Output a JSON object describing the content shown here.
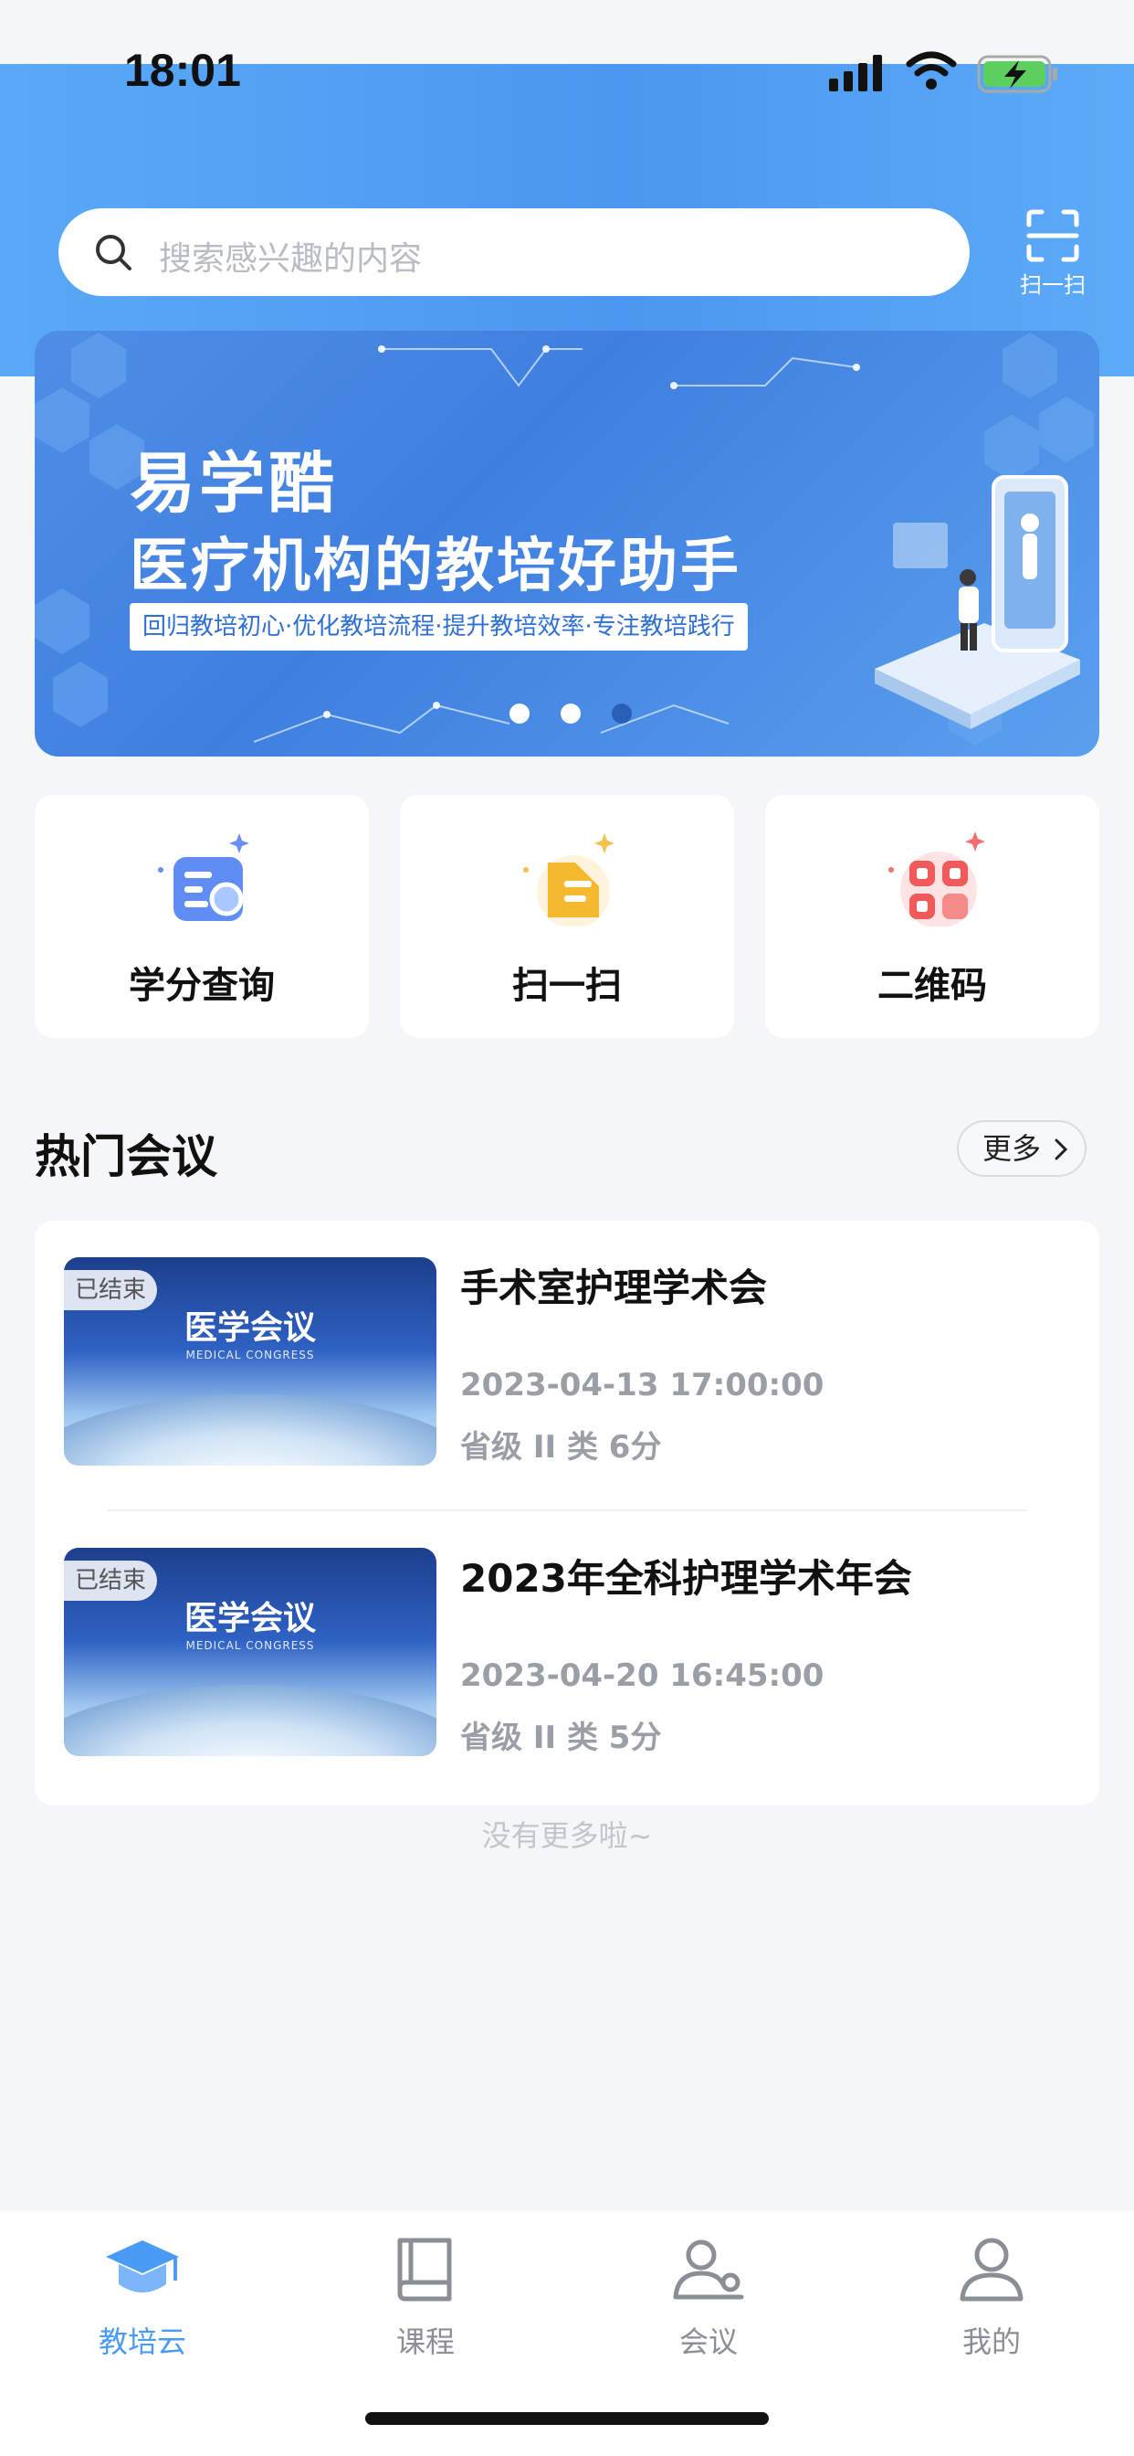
{
  "status_bar": {
    "time": "18:01"
  },
  "search": {
    "placeholder": "搜索感兴趣的内容",
    "scan_label": "扫一扫"
  },
  "banner": {
    "title": "易学酷",
    "subtitle": "医疗机构的教培好助手",
    "tagline": "回归教培初心·优化教培流程·提升教培效率·专注教培践行",
    "dots": 3,
    "active_dot": 2
  },
  "quick_actions": [
    {
      "label": "学分查询",
      "icon": "credit-query-icon"
    },
    {
      "label": "扫一扫",
      "icon": "scan-icon"
    },
    {
      "label": "二维码",
      "icon": "qrcode-icon"
    }
  ],
  "hot_meetings": {
    "title": "热门会议",
    "more_label": "更多",
    "items": [
      {
        "badge": "已结束",
        "thumb_title": "医学会议",
        "thumb_sub": "MEDICAL CONGRESS",
        "title": "手术室护理学术会",
        "time": "2023-04-13 17:00:00",
        "credit": "省级 II 类 6分"
      },
      {
        "badge": "已结束",
        "thumb_title": "医学会议",
        "thumb_sub": "MEDICAL CONGRESS",
        "title": "2023年全科护理学术年会",
        "time": "2023-04-20 16:45:00",
        "credit": "省级 II 类 5分"
      }
    ],
    "end_text": "没有更多啦~"
  },
  "tabbar": {
    "items": [
      {
        "label": "教培云",
        "icon": "graduation-cap-icon",
        "active": true
      },
      {
        "label": "课程",
        "icon": "book-icon",
        "active": false
      },
      {
        "label": "会议",
        "icon": "meeting-icon",
        "active": false
      },
      {
        "label": "我的",
        "icon": "user-icon",
        "active": false
      }
    ]
  },
  "colors": {
    "accent": "#4a9bf5",
    "header_gradient_start": "#5aa9f7",
    "header_gradient_end": "#4c97f1"
  }
}
